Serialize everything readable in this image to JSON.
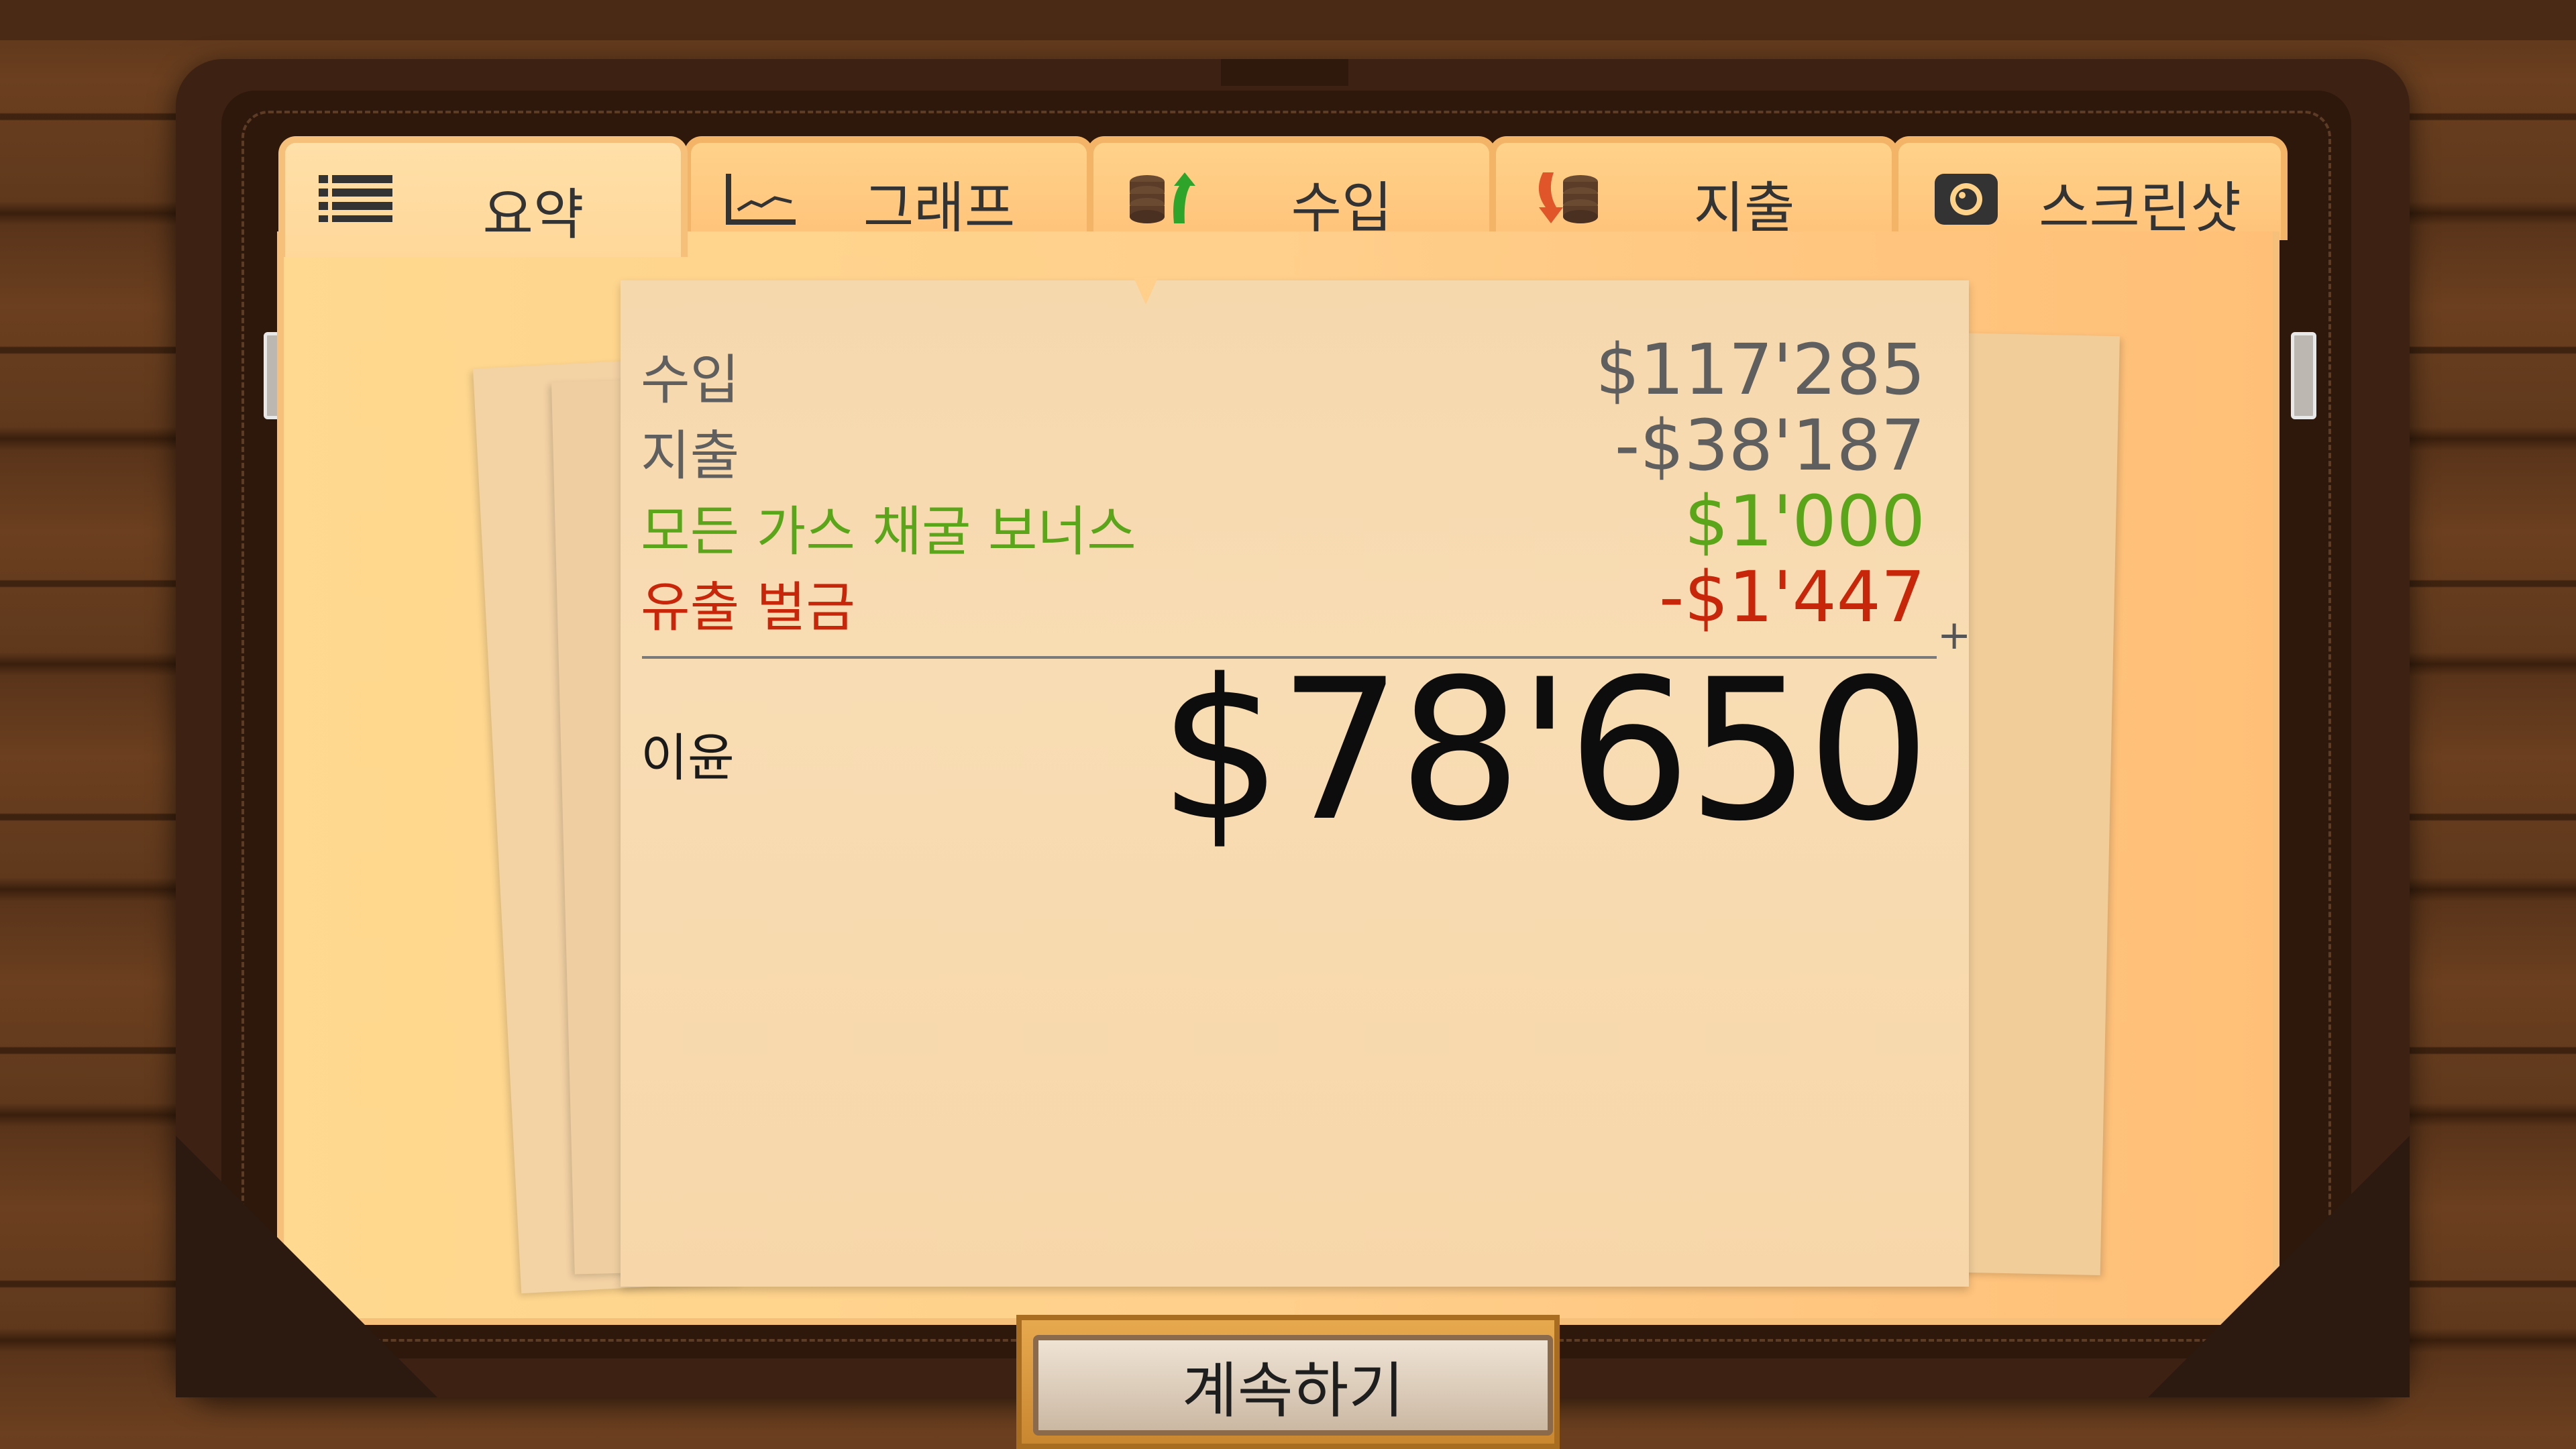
{
  "tabs": [
    {
      "label": "요약",
      "icon": "list-icon",
      "active": true
    },
    {
      "label": "그래프",
      "icon": "line-chart-icon",
      "active": false
    },
    {
      "label": "수입",
      "icon": "coins-up-icon",
      "active": false
    },
    {
      "label": "지출",
      "icon": "coins-down-icon",
      "active": false
    },
    {
      "label": "스크린샷",
      "icon": "camera-icon",
      "active": false
    }
  ],
  "summary": {
    "rows": [
      {
        "label": "수입",
        "value": "$117'285",
        "kind": "neutral"
      },
      {
        "label": "지출",
        "value": "-$38'187",
        "kind": "neutral"
      },
      {
        "label": "모든 가스 채굴 보너스",
        "value": "$1'000",
        "kind": "bonus"
      },
      {
        "label": "유출 벌금",
        "value": "-$1'447",
        "kind": "fine"
      }
    ],
    "plus_sign": "+",
    "profit_label": "이윤",
    "profit_value": "$78'650"
  },
  "continue_button": "계속하기",
  "colors": {
    "neutral": "#5f5f5f",
    "bonus": "#5ba51b",
    "fine": "#c8260a",
    "tab_bg": "#ffd28a",
    "folder": "#3d2213"
  }
}
